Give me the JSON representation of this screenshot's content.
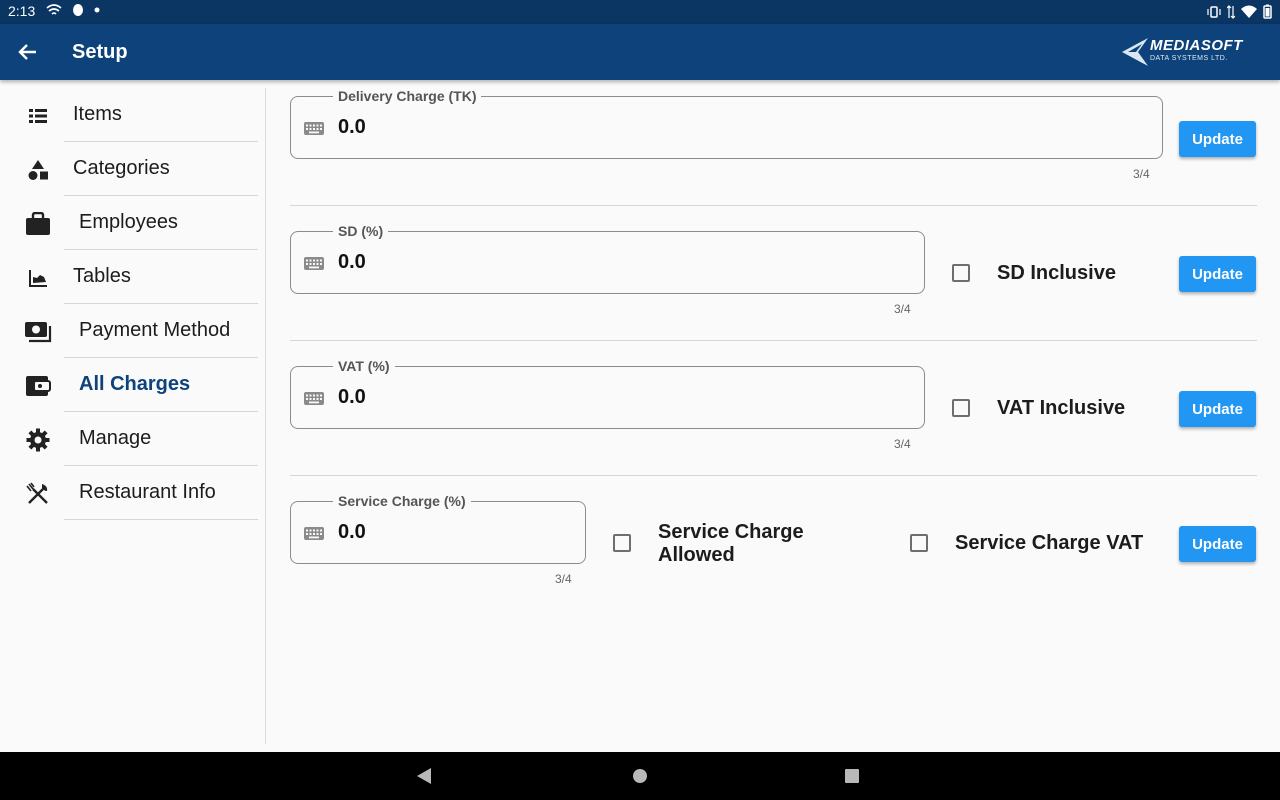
{
  "status_bar": {
    "time": "2:13"
  },
  "appbar": {
    "title": "Setup",
    "logo_text": "MEDIASOFT",
    "logo_sub": "DATA SYSTEMS LTD."
  },
  "sidebar": {
    "items": [
      {
        "label": "Items",
        "icon": "list-icon"
      },
      {
        "label": "Categories",
        "icon": "shapes-icon"
      },
      {
        "label": "Employees",
        "icon": "briefcase-icon"
      },
      {
        "label": "Tables",
        "icon": "table-chart-icon"
      },
      {
        "label": "Payment Method",
        "icon": "payments-icon"
      },
      {
        "label": "All Charges",
        "icon": "wallet-icon",
        "active": true
      },
      {
        "label": "Manage",
        "icon": "gear-icon"
      },
      {
        "label": "Restaurant Info",
        "icon": "utensils-icon"
      }
    ]
  },
  "charges": {
    "delivery": {
      "label": "Delivery Charge (TK)",
      "value": "0.0",
      "counter": "3/4",
      "button": "Update"
    },
    "sd": {
      "label": "SD (%)",
      "value": "0.0",
      "counter": "3/4",
      "checkbox_label": "SD Inclusive",
      "checked": false,
      "button": "Update"
    },
    "vat": {
      "label": "VAT (%)",
      "value": "0.0",
      "counter": "3/4",
      "checkbox_label": "VAT Inclusive",
      "checked": false,
      "button": "Update"
    },
    "service": {
      "label": "Service Charge (%)",
      "value": "0.0",
      "counter": "3/4",
      "allowed_label_line1": "Service Charge",
      "allowed_label_line2": "Allowed",
      "allowed_checked": false,
      "vat_label": "Service Charge VAT",
      "vat_checked": false,
      "button": "Update"
    }
  },
  "colors": {
    "appbar": "#0d427a",
    "statusbar": "#0b3563",
    "accent": "#2196f3",
    "active_text": "#0d427a"
  }
}
